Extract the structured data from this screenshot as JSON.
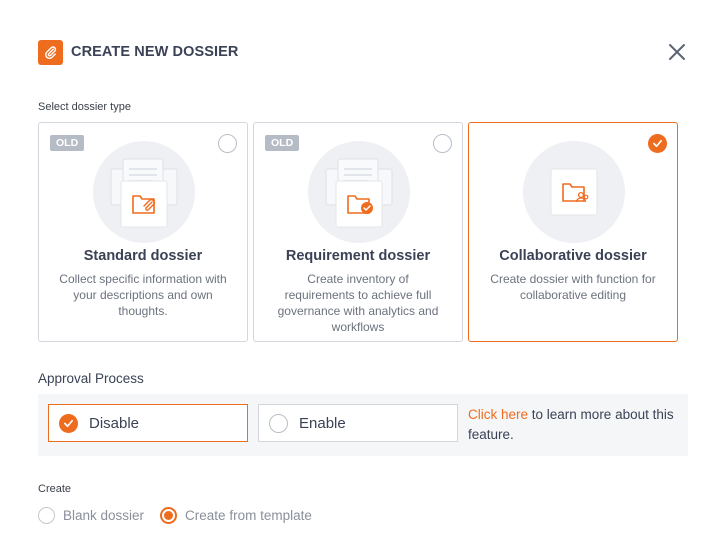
{
  "dialog": {
    "title": "CREATE NEW DOSSIER",
    "icon": "paperclip-icon",
    "close_icon": "close-icon"
  },
  "dossier_type": {
    "label": "Select dossier type",
    "cards": [
      {
        "badge": "OLD",
        "title": "Standard dossier",
        "description": "Collect specific information with your descriptions and own thoughts.",
        "selected": false,
        "icon": "folder-paperclip-icon"
      },
      {
        "badge": "OLD",
        "title": "Requirement dossier",
        "description": "Create inventory of requirements to achieve full governance with analytics and workflows",
        "selected": false,
        "icon": "folder-check-icon"
      },
      {
        "badge": "",
        "title": "Collaborative dossier",
        "description": "Create dossier with function for collaborative editing",
        "selected": true,
        "icon": "folder-users-icon"
      }
    ]
  },
  "approval": {
    "label": "Approval Process",
    "options": [
      {
        "label": "Disable",
        "selected": true
      },
      {
        "label": "Enable",
        "selected": false
      }
    ],
    "link_text": "Click here",
    "info_text": " to learn more about this feature."
  },
  "create": {
    "label": "Create",
    "options": [
      {
        "label": "Blank dossier",
        "selected": false
      },
      {
        "label": "Create from template",
        "selected": true
      }
    ]
  },
  "colors": {
    "accent": "#ee6c1e",
    "text": "#3b4256",
    "muted": "#6c727e",
    "badge": "#b6bcc5"
  }
}
